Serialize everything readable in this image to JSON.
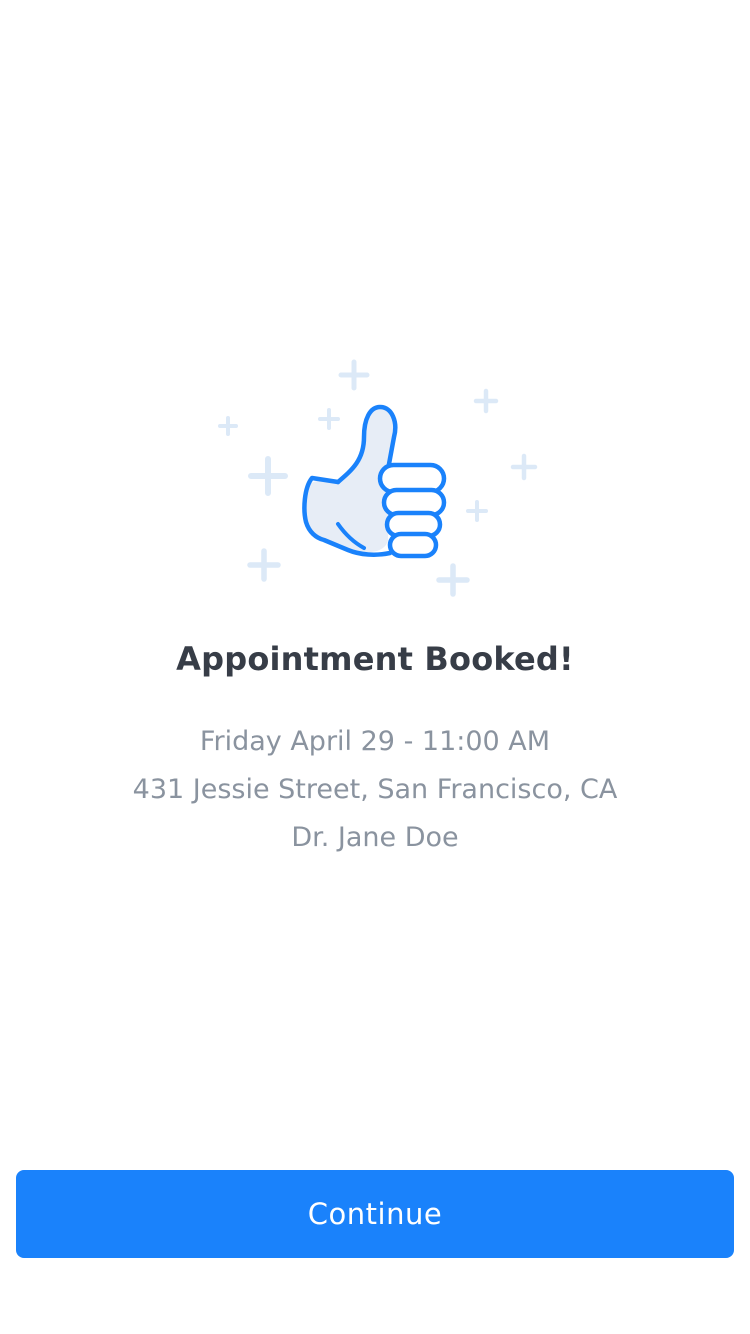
{
  "confirmation": {
    "title": "Appointment Booked!",
    "datetime": "Friday April 29 - 11:00 AM",
    "address": "431 Jessie Street, San Francisco, CA",
    "doctor": "Dr. Jane Doe"
  },
  "actions": {
    "continue_label": "Continue"
  },
  "illustration": {
    "icon": "thumbs-up-icon",
    "decoration": "sparkle-plus-icons"
  },
  "colors": {
    "accent": "#1a82fb",
    "title": "#373d47",
    "detail_text": "#8a939f",
    "sparkle": "#dce9f7"
  }
}
